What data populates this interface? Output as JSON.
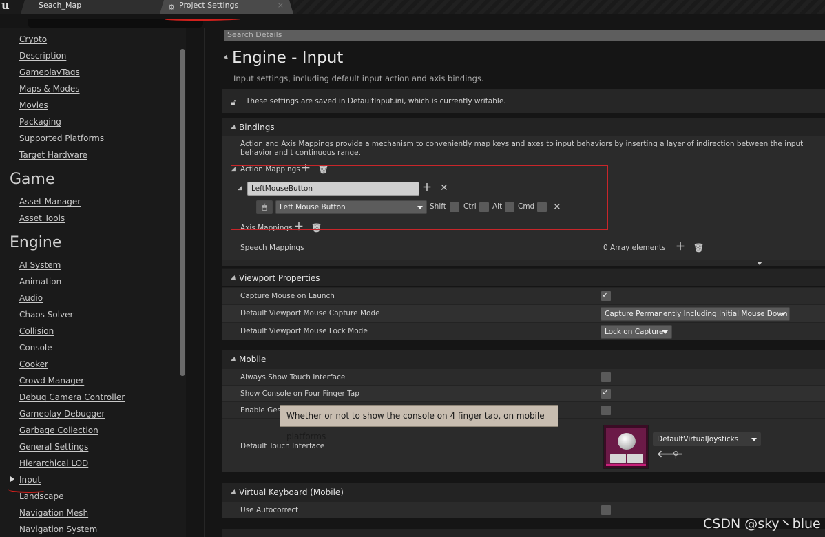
{
  "tabs": [
    {
      "label": "Seach_Map"
    },
    {
      "label": "Project Settings",
      "close": "×"
    }
  ],
  "sidebar": {
    "items_top": [
      "Crypto",
      "Description",
      "GameplayTags",
      "Maps & Modes",
      "Movies",
      "Packaging",
      "Supported Platforms",
      "Target Hardware"
    ],
    "section_game": "Game",
    "items_game": [
      "Asset Manager",
      "Asset Tools"
    ],
    "section_engine": "Engine",
    "items_engine": [
      "AI System",
      "Animation",
      "Audio",
      "Chaos Solver",
      "Collision",
      "Console",
      "Cooker",
      "Crowd Manager",
      "Debug Camera Controller",
      "Gameplay Debugger",
      "Garbage Collection",
      "General Settings",
      "Hierarchical LOD",
      "Input",
      "Landscape",
      "Navigation Mesh",
      "Navigation System"
    ]
  },
  "search": {
    "placeholder": "Search Details"
  },
  "page": {
    "title": "Engine - Input",
    "subtitle": "Input settings, including default input action and axis bindings.",
    "info": "These settings are saved in DefaultInput.ini, which is currently writable."
  },
  "bindings": {
    "header": "Bindings",
    "description": "Action and Axis Mappings provide a mechanism to conveniently map keys and axes to input behaviors by inserting a layer of indirection between the input behavior and t continuous range.",
    "action_mappings_label": "Action Mappings",
    "action_name": "LeftMouseButton",
    "key": "Left Mouse Button",
    "modifiers": [
      "Shift",
      "Ctrl",
      "Alt",
      "Cmd"
    ],
    "axis_mappings_label": "Axis Mappings",
    "speech_label": "Speech Mappings",
    "speech_value": "0 Array elements"
  },
  "viewport": {
    "header": "Viewport Properties",
    "capture_on_launch": "Capture Mouse on Launch",
    "capture_mode_label": "Default Viewport Mouse Capture Mode",
    "capture_mode_value": "Capture Permanently Including Initial Mouse Down",
    "lock_mode_label": "Default Viewport Mouse Lock Mode",
    "lock_mode_value": "Lock on Capture"
  },
  "mobile": {
    "header": "Mobile",
    "always_touch": "Always Show Touch Interface",
    "console_four_finger": "Show Console on Four Finger Tap",
    "enable_gesture": "Enable Ges",
    "touch_interface_label": "Default Touch Interface",
    "touch_interface_value": "DefaultVirtualJoysticks",
    "tooltip": "Whether or not to show the console on 4 finger tap, on mobile platforms"
  },
  "vkeyboard": {
    "header": "Virtual Keyboard (Mobile)",
    "autocorrect": "Use Autocorrect"
  },
  "watermark": "CSDN @sky丶blue"
}
